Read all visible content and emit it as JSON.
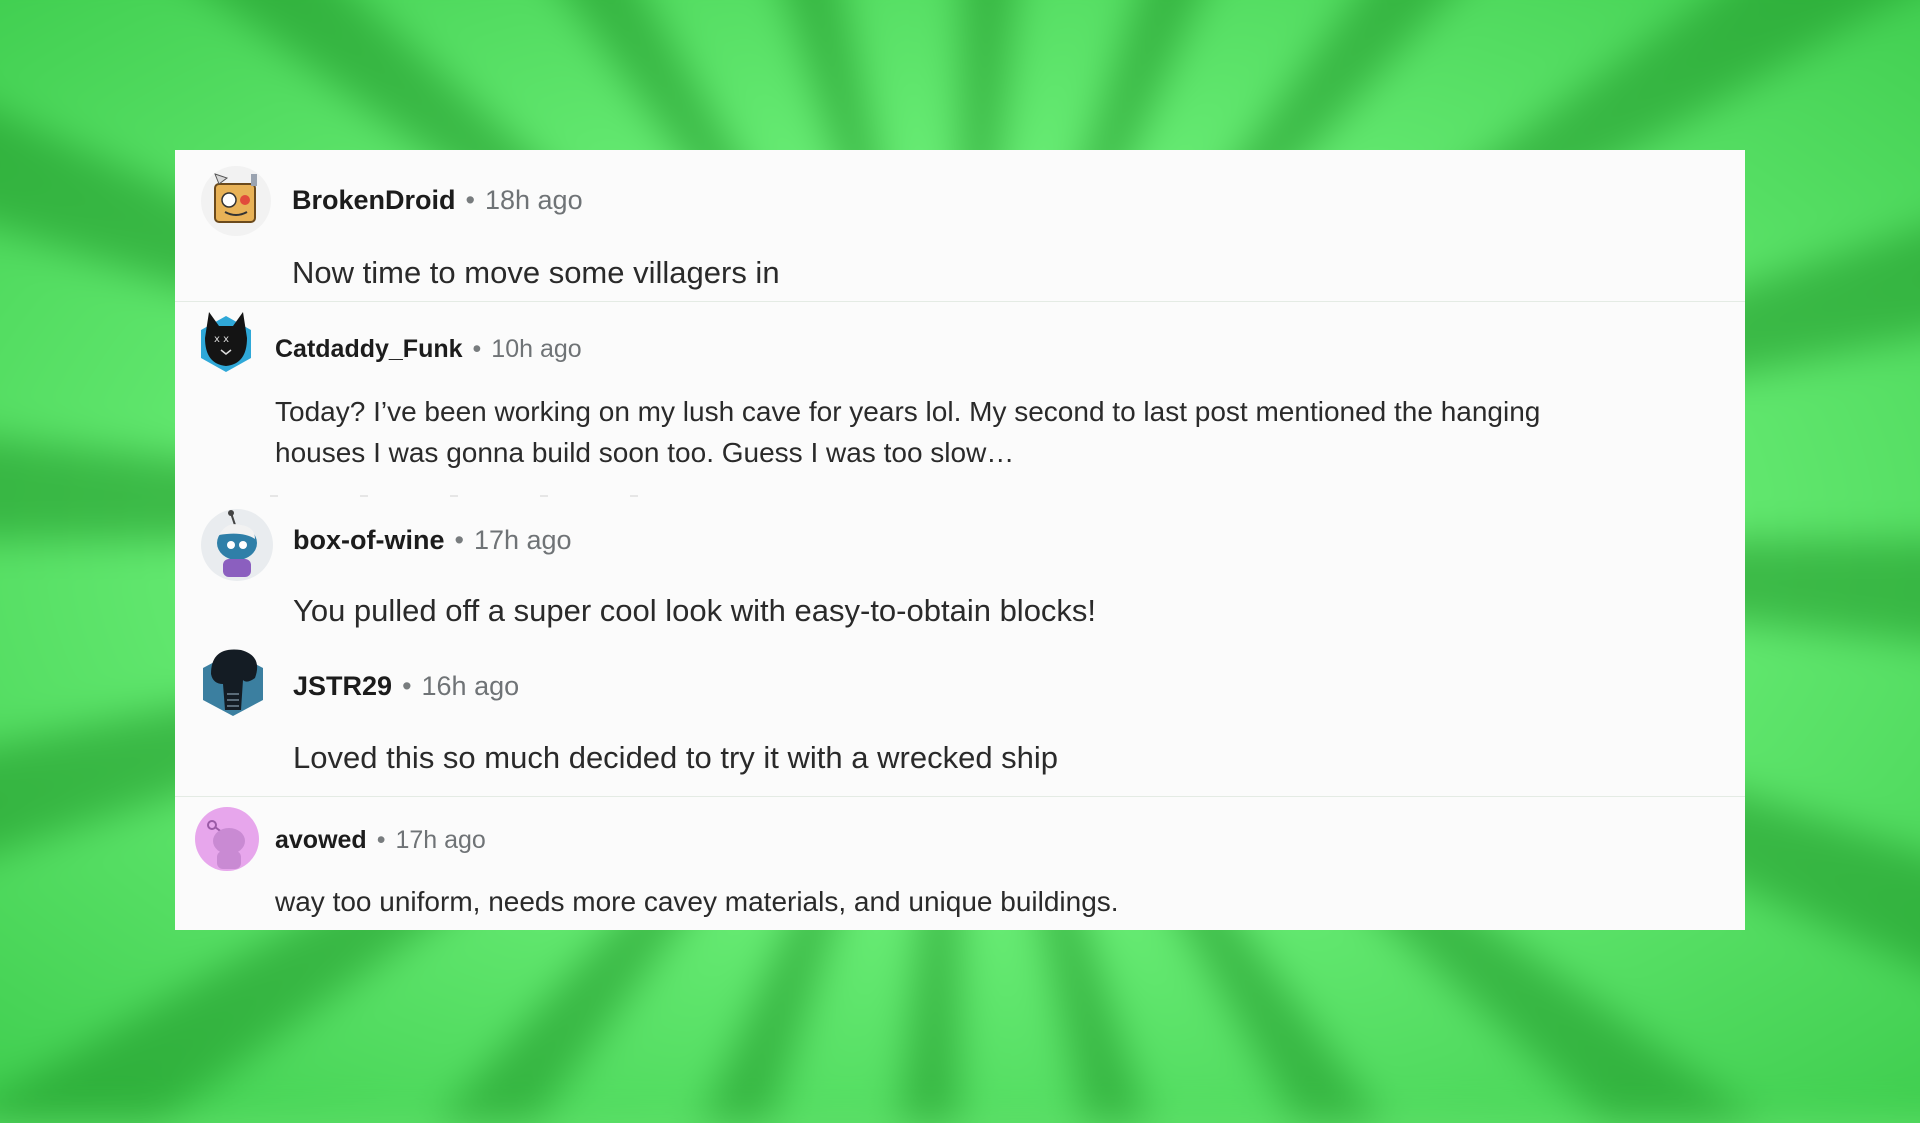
{
  "comments": [
    {
      "username": "BrokenDroid",
      "separator": "•",
      "time": "18h ago",
      "text": "Now time to move some villagers in",
      "avatar_icon": "robot-box-avatar-icon"
    },
    {
      "username": "Catdaddy_Funk",
      "separator": "•",
      "time": "10h ago",
      "text_line1": "Today? I’ve been working on my lush cave for years lol. My second to last post mentioned the hanging",
      "text_line2": "houses I was gonna build soon too. Guess I was too slow…",
      "avatar_icon": "black-cat-avatar-icon"
    },
    {
      "username": "box-of-wine",
      "separator": "•",
      "time": "17h ago",
      "text": "You pulled off a super cool look with easy-to-obtain blocks!",
      "avatar_icon": "blue-snoo-avatar-icon"
    },
    {
      "username": "JSTR29",
      "separator": "•",
      "time": "16h ago",
      "text": "Loved this so much decided to try it with a wrecked ship",
      "avatar_icon": "alien-avatar-icon"
    },
    {
      "username": "avowed",
      "separator": "•",
      "time": "17h ago",
      "text": "way too uniform, needs more cavey materials, and unique buildings.",
      "avatar_icon": "default-snoo-avatar-icon"
    }
  ],
  "colors": {
    "background": "#5fe06a",
    "panel": "#fbfbfb",
    "username": "#1c1c1c",
    "meta": "#6f7376"
  }
}
